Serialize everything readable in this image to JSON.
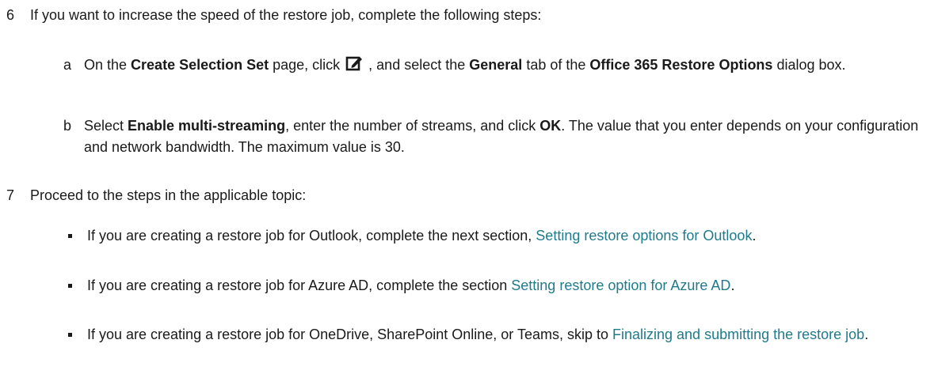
{
  "step6": {
    "number": "6",
    "text": "If you want to increase the speed of the restore job, complete the following steps:",
    "sub_a": {
      "letter": "a",
      "p1": "On the ",
      "b1": "Create Selection Set",
      "p2": " page, click ",
      "icon": "edit-icon",
      "p3": " , and select the ",
      "b2": "General",
      "p4": " tab of the ",
      "b3": "Office 365 Restore Options",
      "p5": " dialog box."
    },
    "sub_b": {
      "letter": "b",
      "p1": "Select ",
      "b1": "Enable multi-streaming",
      "p2": ", enter the number of streams, and click ",
      "b2": "OK",
      "p3": ". The value that you enter depends on your configuration and network bandwidth. The maximum value is 30."
    }
  },
  "step7": {
    "number": "7",
    "text": "Proceed to the steps in the applicable topic:",
    "bullets": [
      {
        "prefix": "If you are creating a restore job for Outlook, complete the next section, ",
        "link": "Setting restore options for Outlook",
        "suffix": "."
      },
      {
        "prefix": "If you are creating a restore job for Azure AD, complete the section ",
        "link": "Setting restore option for Azure AD",
        "suffix": "."
      },
      {
        "prefix": "If you are creating a restore job for OneDrive, SharePoint Online, or Teams, skip to ",
        "link": "Finalizing and submitting the restore job",
        "suffix": "."
      }
    ]
  },
  "colors": {
    "text": "#1a1a1a",
    "link": "#1f7a8c"
  }
}
